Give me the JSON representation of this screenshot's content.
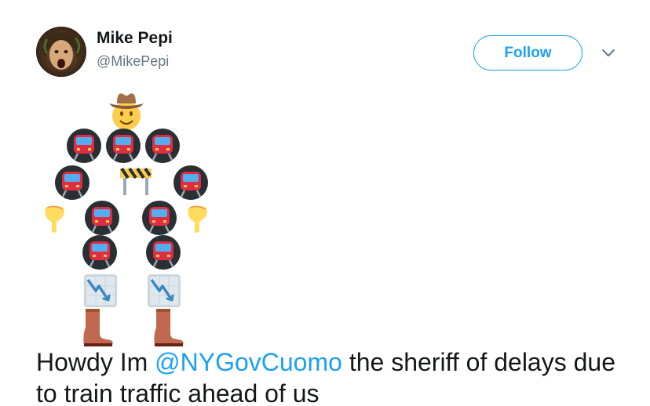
{
  "user": {
    "display_name": "Mike Pepi",
    "handle": "@MikePepi"
  },
  "actions": {
    "follow_label": "Follow"
  },
  "tweet": {
    "text_before": "Howdy Im ",
    "mention": "@NYGovCuomo",
    "text_after": " the sheriff of delays due to train traffic ahead of us"
  },
  "emoji_art": {
    "hat": "cowboy-hat-face",
    "body": "metro-train",
    "chest": "construction-barrier",
    "hands": "pointing-down-hand",
    "legs": "chart-decreasing",
    "feet": "cowboy-boot"
  },
  "colors": {
    "accent": "#1da1f2",
    "text": "#14171a",
    "secondary": "#657786"
  }
}
